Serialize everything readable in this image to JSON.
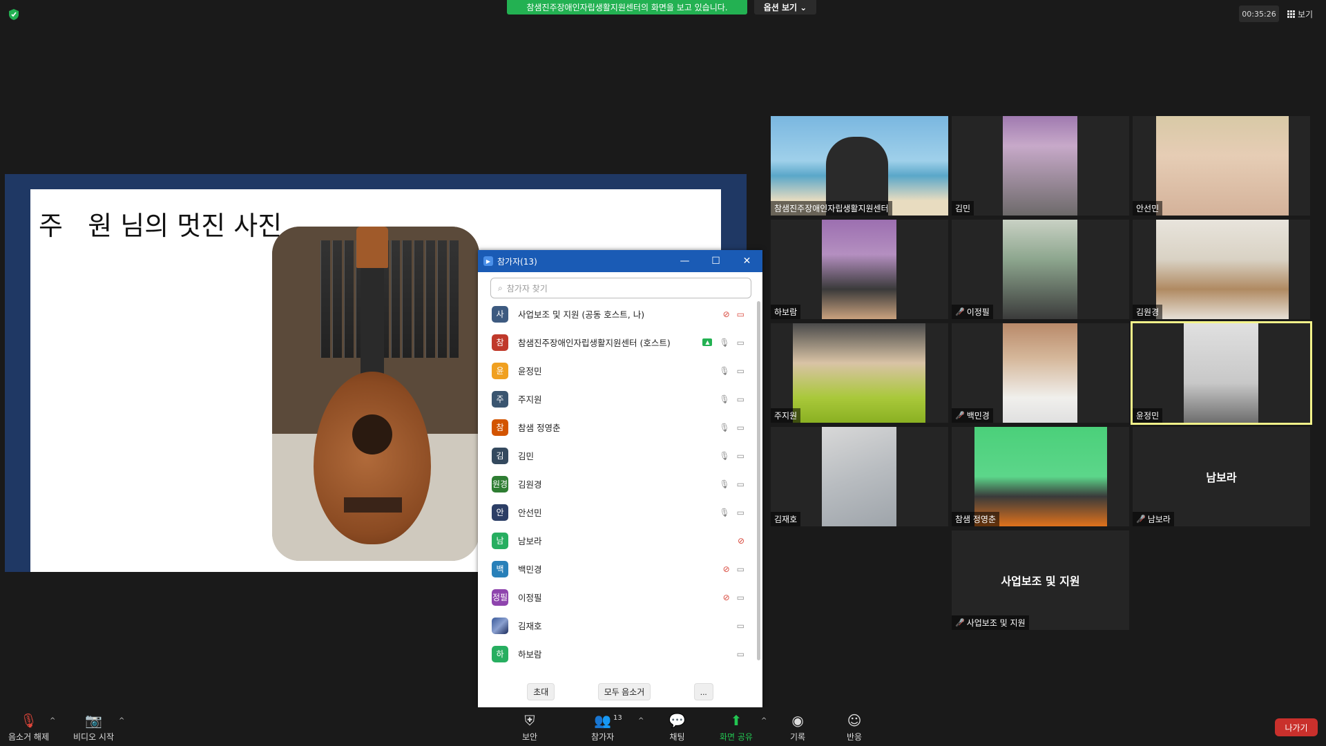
{
  "top": {
    "share_banner": "참샘진주장애인자립생활지원센터의 화면을 보고 있습니다.",
    "view_options": "옵션 보기 ⌄",
    "timer": "00:35:26",
    "view_label": "보기"
  },
  "slide": {
    "title": "주   원 님의 멋진 사진"
  },
  "videos": [
    {
      "name": "참샘진주장애인자립생활지원센터",
      "muted": false
    },
    {
      "name": "김민",
      "muted": false
    },
    {
      "name": "안선민",
      "muted": false
    },
    {
      "name": "하보람",
      "muted": false
    },
    {
      "name": "이정필",
      "muted": true
    },
    {
      "name": "김원경",
      "muted": false
    },
    {
      "name": "주지원",
      "muted": false
    },
    {
      "name": "백민경",
      "muted": true
    },
    {
      "name": "윤정민",
      "muted": false
    },
    {
      "name": "김재호",
      "muted": false
    },
    {
      "name": "참샘 정영춘",
      "muted": false
    },
    {
      "name": "남보라",
      "muted": true,
      "big_name": "남보라"
    },
    {
      "name": "사업보조 및 지원",
      "muted": true,
      "big_name": "사업보조 및 지원"
    }
  ],
  "panel": {
    "title": "참가자(13)",
    "search_placeholder": "참가자 찾기",
    "participants": [
      {
        "initial": "사",
        "name": "사업보조 및 지원 (공동 호스트, 나)",
        "color": "#3d5a80",
        "mic": "off",
        "cam": "off"
      },
      {
        "initial": "참",
        "name": "참샘진주장애인자립생활지원센터 (호스트)",
        "color": "#c0392b",
        "mic": "on",
        "cam": "on",
        "sharing": true
      },
      {
        "initial": "윤",
        "name": "윤정민",
        "color": "#f0a020",
        "mic": "on",
        "cam": "on"
      },
      {
        "initial": "주",
        "name": "주지원",
        "color": "#3a5570",
        "mic": "on",
        "cam": "on"
      },
      {
        "initial": "참",
        "name": "참샘  정영춘",
        "color": "#d35400",
        "mic": "on",
        "cam": "on"
      },
      {
        "initial": "김",
        "name": "김민",
        "color": "#34495e",
        "mic": "on",
        "cam": "on"
      },
      {
        "initial": "원경",
        "name": "김원경",
        "color": "#2e7d32",
        "mic": "on",
        "cam": "on"
      },
      {
        "initial": "안",
        "name": "안선민",
        "color": "#2c3e66",
        "mic": "on",
        "cam": "on"
      },
      {
        "initial": "남",
        "name": "남보라",
        "color": "#27ae60",
        "mic": "off",
        "cam": "none"
      },
      {
        "initial": "백",
        "name": "백민경",
        "color": "#2980b9",
        "mic": "off",
        "cam": "on"
      },
      {
        "initial": "정필",
        "name": "이정필",
        "color": "#8e44ad",
        "mic": "off",
        "cam": "on"
      },
      {
        "initial": "",
        "name": "김재호",
        "color": "#ffffff",
        "mic": "none",
        "cam": "on",
        "image": true
      },
      {
        "initial": "하",
        "name": "하보람",
        "color": "#27ae60",
        "mic": "none",
        "cam": "on"
      }
    ],
    "invite": "초대",
    "mute_all": "모두 음소거",
    "more": "..."
  },
  "toolbar": {
    "unmute": "음소거 해제",
    "start_video": "비디오 시작",
    "security": "보안",
    "participants": "참가자",
    "participants_count": "13",
    "chat": "채팅",
    "share": "화면 공유",
    "record": "기록",
    "reactions": "반응",
    "leave": "나가기"
  }
}
